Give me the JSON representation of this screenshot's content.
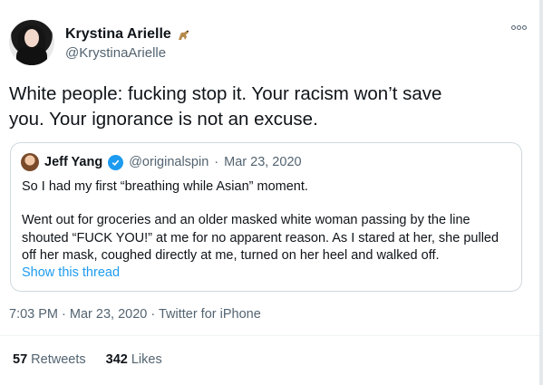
{
  "author": {
    "name": "Krystina Arielle",
    "handle": "@KrystinaArielle",
    "name_emoji": "dinosaur-emoji-icon"
  },
  "tweet": {
    "text_line1": "White people: fucking stop it. Your racism won’t save",
    "text_line2": "you. Your ignorance is not an excuse."
  },
  "quote": {
    "name": "Jeff Yang",
    "handle": "@originalspin",
    "dot": "·",
    "date": "Mar 23, 2020",
    "line1": "So I had my first “breathing while Asian” moment.",
    "line2": "Went out for groceries and an older masked white woman passing by the line",
    "line3": "shouted “FUCK YOU!” at me for no apparent reason. As I stared at her, she pulled",
    "line4": "off her mask, coughed directly at me, turned on her heel and walked off.",
    "show_thread": "Show this thread"
  },
  "meta": {
    "time_date_source": "7:03 PM · Mar 23, 2020 · Twitter for iPhone"
  },
  "stats": {
    "retweets_count": "57",
    "retweets_label": "Retweets",
    "likes_count": "342",
    "likes_label": "Likes"
  },
  "colors": {
    "link": "#1d9bf0",
    "secondary_text": "#536471",
    "border": "#cfd9de"
  }
}
